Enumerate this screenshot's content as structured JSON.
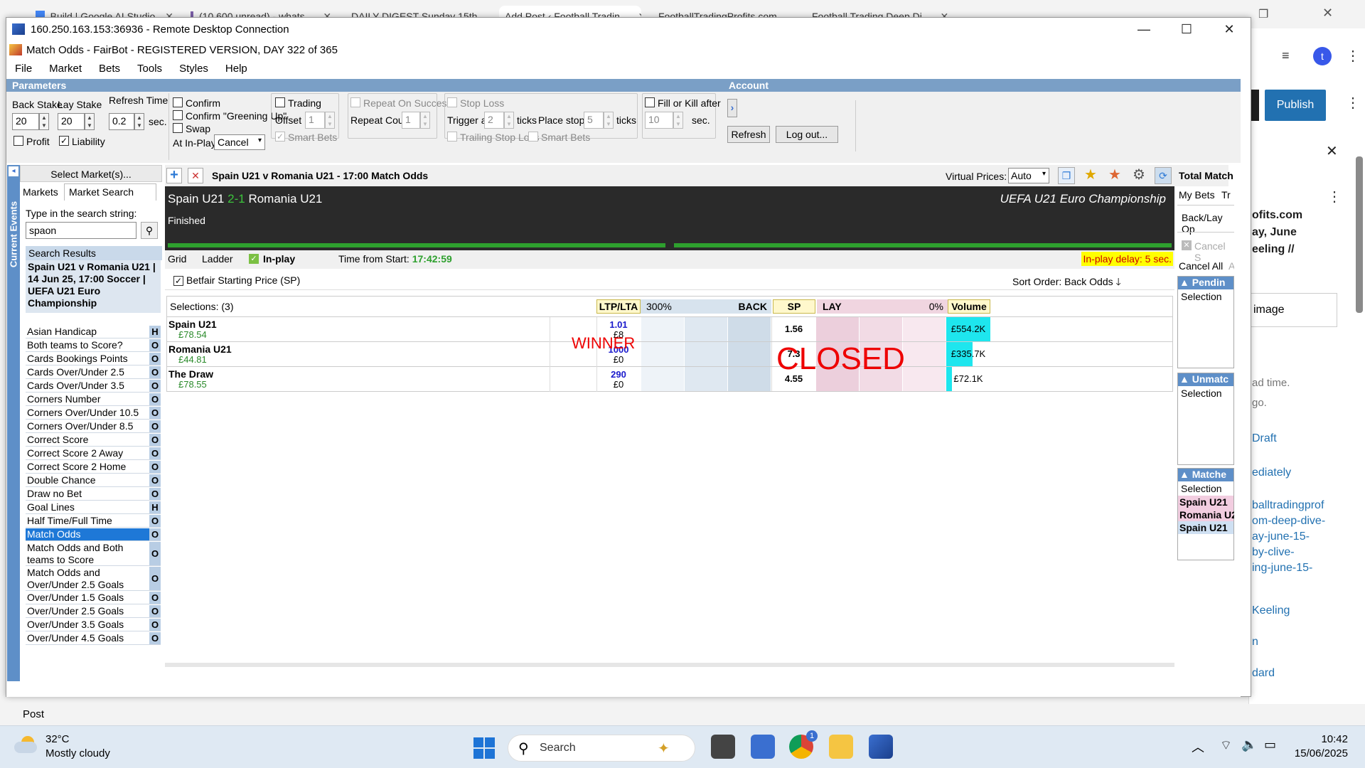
{
  "browser": {
    "tabs": [
      {
        "label": "Build | Google AI Studio"
      },
      {
        "label": "(10,600 unread) - whats..."
      },
      {
        "label": "DAILY DIGEST Sunday 15th..."
      },
      {
        "label": "Add Post ‹ Football Tradin..."
      },
      {
        "label": "FootballTradingProfits.com..."
      },
      {
        "label": "Football Trading Deep Di..."
      }
    ],
    "avatar_letter": "t",
    "publish_label": "Publish",
    "close_glyph": "✕",
    "more_glyph": "⋮",
    "sidebar_lines": [
      "ofits.com",
      "ay, June",
      "eeling //"
    ],
    "image_label": "image",
    "help_lines": [
      "ad time.",
      "go."
    ],
    "links": [
      "Draft",
      "ediately",
      "balltradingprof",
      "om-deep-dive-",
      "ay-june-15-",
      "by-clive-",
      "ing-june-15-",
      "Keeling",
      "n",
      "dard"
    ]
  },
  "rdp": {
    "title": "160.250.163.153:36936 - Remote Desktop Connection",
    "min": "—",
    "max": "☐",
    "close": "✕"
  },
  "fairbot": {
    "title": "Match Odds - FairBot - REGISTERED VERSION, DAY 322 of 365",
    "menu": [
      "File",
      "Market",
      "Bets",
      "Tools",
      "Styles",
      "Help"
    ],
    "parameters_label": "Parameters",
    "account_label": "Account",
    "back_stake_label": "Back Stake",
    "back_stake": "20",
    "lay_stake_label": "Lay Stake",
    "lay_stake": "20",
    "refresh_time_label": "Refresh Time",
    "refresh_time": "0.2",
    "sec": "sec.",
    "profit_label": "Profit",
    "liability_label": "Liability",
    "confirm_label": "Confirm",
    "confirm_greening_label": "Confirm \"Greening Up\"",
    "swap_label": "Swap",
    "at_inplay_label": "At In-Play:",
    "at_inplay_value": "Cancel",
    "trading_label": "Trading",
    "offset_label": "Offset",
    "offset": "1",
    "smart_bets_label": "Smart Bets",
    "repeat_success_label": "Repeat On Success",
    "repeat_count_label": "Repeat Count",
    "repeat_count": "1",
    "stop_loss_label": "Stop Loss",
    "trigger_label": "Trigger at",
    "trigger": "2",
    "ticks": "ticks",
    "place_stop_label": "Place stop at",
    "place_stop": "5",
    "trailing_label": "Trailing Stop Loss",
    "smart_bets2_label": "Smart Bets",
    "fill_kill_label": "Fill or Kill after",
    "fill_kill": "10",
    "refresh_btn": "Refresh",
    "logout_btn": "Log out...",
    "arrow_btn": "›"
  },
  "left": {
    "vertical_label": "Current Events",
    "select_markets": "Select Market(s)...",
    "tab_markets": "Markets",
    "tab_search": "Market Search",
    "search_prompt": "Type in the search string:",
    "search_value": "spaon",
    "results_header": "Search Results",
    "event_title": "Spain U21 v Romania U21 | 14 Jun 25, 17:00 Soccer | UEFA U21 Euro Championship",
    "markets": [
      {
        "name": "Asian Handicap",
        "tag": "H"
      },
      {
        "name": "Both teams to Score?",
        "tag": "O"
      },
      {
        "name": "Cards Bookings Points",
        "tag": "O"
      },
      {
        "name": "Cards Over/Under 2.5",
        "tag": "O"
      },
      {
        "name": "Cards Over/Under 3.5",
        "tag": "O"
      },
      {
        "name": "Corners Number",
        "tag": "O"
      },
      {
        "name": "Corners Over/Under 10.5",
        "tag": "O"
      },
      {
        "name": "Corners Over/Under 8.5",
        "tag": "O"
      },
      {
        "name": "Correct Score",
        "tag": "O"
      },
      {
        "name": "Correct Score 2 Away",
        "tag": "O"
      },
      {
        "name": "Correct Score 2 Home",
        "tag": "O"
      },
      {
        "name": "Double Chance",
        "tag": "O"
      },
      {
        "name": "Draw no Bet",
        "tag": "O"
      },
      {
        "name": "Goal Lines",
        "tag": "H"
      },
      {
        "name": "Half Time/Full Time",
        "tag": "O"
      },
      {
        "name": "Match Odds",
        "tag": "O"
      },
      {
        "name": "Match Odds and Both teams to Score",
        "tag": "O"
      },
      {
        "name": "Match Odds and Over/Under 2.5 Goals",
        "tag": "O"
      },
      {
        "name": "Over/Under 1.5 Goals",
        "tag": "O"
      },
      {
        "name": "Over/Under 2.5 Goals",
        "tag": "O"
      },
      {
        "name": "Over/Under 3.5 Goals",
        "tag": "O"
      },
      {
        "name": "Over/Under 4.5 Goals",
        "tag": "O"
      }
    ]
  },
  "main": {
    "market_title": "Spain U21 v Romania U21 - 17:00 Match Odds",
    "virtual_prices_label": "Virtual Prices:",
    "virtual_prices": "Auto",
    "total_matched": "Total Match",
    "home": "Spain U21",
    "score": "2-1",
    "away": "Romania U21",
    "competition": "UEFA U21 Euro Championship",
    "status": "Finished",
    "tab_grid": "Grid",
    "tab_ladder": "Ladder",
    "inplay": "In-play",
    "time_label": "Time from Start:",
    "time_value": "17:42:59",
    "inplay_delay": "In-play delay: 5 sec.",
    "bsp_label": "Betfair Starting Price (SP)",
    "sort_order": "Sort Order: Back Odds",
    "selections_label": "Selections: (3)",
    "col_ltp": "LTP/LTA",
    "col_back_pct": "300%",
    "col_back": "BACK",
    "col_sp": "SP",
    "col_lay": "LAY",
    "col_lay_pct": "0%",
    "col_volume": "Volume",
    "winner": "WINNER",
    "closed": "CLOSED",
    "rows": [
      {
        "name": "Spain U21",
        "pl": "£78.54",
        "ltp": "1.01",
        "lta": "£8",
        "sp": "1.56",
        "volume": "£554.2K",
        "vol_fill": 1.0
      },
      {
        "name": "Romania U21",
        "pl": "£44.81",
        "ltp": "1000",
        "lta": "£0",
        "sp": "7.3",
        "volume": "£335.7K",
        "vol_fill": 0.6
      },
      {
        "name": "The Draw",
        "pl": "£78.55",
        "ltp": "290",
        "lta": "£0",
        "sp": "4.55",
        "volume": "£72.1K",
        "vol_fill": 0.13
      }
    ]
  },
  "right": {
    "tab_mybets": "My Bets",
    "tab_tr": "Tr",
    "back_lay": "Back/Lay Op",
    "cancel_s": "Cancel S",
    "cancel_all": "Cancel All",
    "a": "A",
    "pending": "Pendin",
    "selection": "Selection",
    "unmatched": "Unmatc",
    "selection2": "Selection",
    "matched": "Matche",
    "selection3": "Selection",
    "matched_rows": [
      "Spain U21",
      "Romania U2",
      "Spain U21"
    ]
  },
  "statusbar": {
    "post": "Post"
  },
  "taskbar": {
    "temp": "32°C",
    "weather": "Mostly cloudy",
    "search": "Search",
    "time": "10:42",
    "date": "15/06/2025",
    "chrome_badge": "1"
  }
}
